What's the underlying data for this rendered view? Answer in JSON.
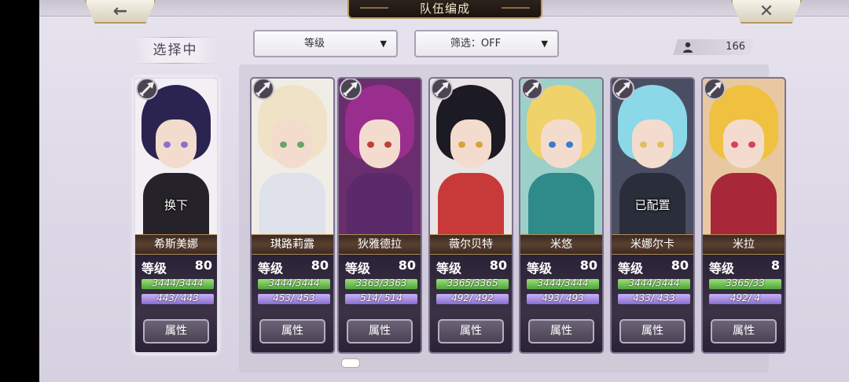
{
  "header": {
    "title": "队伍编成",
    "back_icon": "←",
    "close_icon": "✕"
  },
  "selecting_label": "选择中",
  "dropdowns": {
    "sort": {
      "label": "等级",
      "arrow": "▼"
    },
    "filter": {
      "label": "筛选：OFF",
      "arrow": "▼"
    }
  },
  "count": {
    "value": "166",
    "icon": "user-icon"
  },
  "selected_card": {
    "name": "希斯美娜",
    "status": "换下",
    "level_label": "等级",
    "level": "80",
    "hp_text": "3444/3444",
    "mp_text": "443/ 443",
    "hp_fraction": 1.0,
    "mp_fraction": 1.0,
    "attr_label": "属性",
    "colors": {
      "bg": "#f2f0f4",
      "hair": "#2b2350",
      "body": "#26222a",
      "eye": "#8a6fd0"
    }
  },
  "roster": [
    {
      "name": "琪路莉露",
      "status": "",
      "level_label": "等级",
      "level": "80",
      "hp_text": "3444/3444",
      "mp_text": "453/ 453",
      "hp_fraction": 1.0,
      "mp_fraction": 1.0,
      "attr_label": "属性",
      "colors": {
        "bg": "#f0ece6",
        "hair": "#efe2c6",
        "body": "#dfe2ea",
        "eye": "#6aa46a"
      }
    },
    {
      "name": "狄雅德拉",
      "status": "",
      "level_label": "等级",
      "level": "80",
      "hp_text": "3363/3363",
      "mp_text": "514/ 514",
      "hp_fraction": 1.0,
      "mp_fraction": 1.0,
      "attr_label": "属性",
      "colors": {
        "bg": "#6a2e6e",
        "hair": "#9a2e8e",
        "body": "#5a2a6a",
        "eye": "#c0403a"
      }
    },
    {
      "name": "薇尔贝特",
      "status": "",
      "level_label": "等级",
      "level": "80",
      "hp_text": "3365/3365",
      "mp_text": "492/ 492",
      "hp_fraction": 1.0,
      "mp_fraction": 1.0,
      "attr_label": "属性",
      "colors": {
        "bg": "#e9e4e6",
        "hair": "#1c1a22",
        "body": "#c83a3a",
        "eye": "#d8a23a"
      }
    },
    {
      "name": "米悠",
      "status": "",
      "level_label": "等级",
      "level": "80",
      "hp_text": "3444/3444",
      "mp_text": "493/ 493",
      "hp_fraction": 1.0,
      "mp_fraction": 1.0,
      "attr_label": "属性",
      "colors": {
        "bg": "#9ad0c8",
        "hair": "#f0d26a",
        "body": "#2f8a8a",
        "eye": "#3a7ad0"
      }
    },
    {
      "name": "米娜尔卡",
      "status": "已配置",
      "level_label": "等级",
      "level": "80",
      "hp_text": "3444/3444",
      "mp_text": "433/ 433",
      "hp_fraction": 1.0,
      "mp_fraction": 1.0,
      "attr_label": "属性",
      "colors": {
        "bg": "#4a4e62",
        "hair": "#8ad8e8",
        "body": "#2a2e3a",
        "eye": "#e0c060"
      }
    },
    {
      "name": "米拉",
      "status": "",
      "level_label": "等级",
      "level": "8",
      "hp_text": "3365/33",
      "mp_text": "492/ 4",
      "hp_fraction": 1.0,
      "mp_fraction": 1.0,
      "attr_label": "属性",
      "colors": {
        "bg": "#e8c8a0",
        "hair": "#f0c040",
        "body": "#a8283a",
        "eye": "#d84060"
      }
    }
  ]
}
